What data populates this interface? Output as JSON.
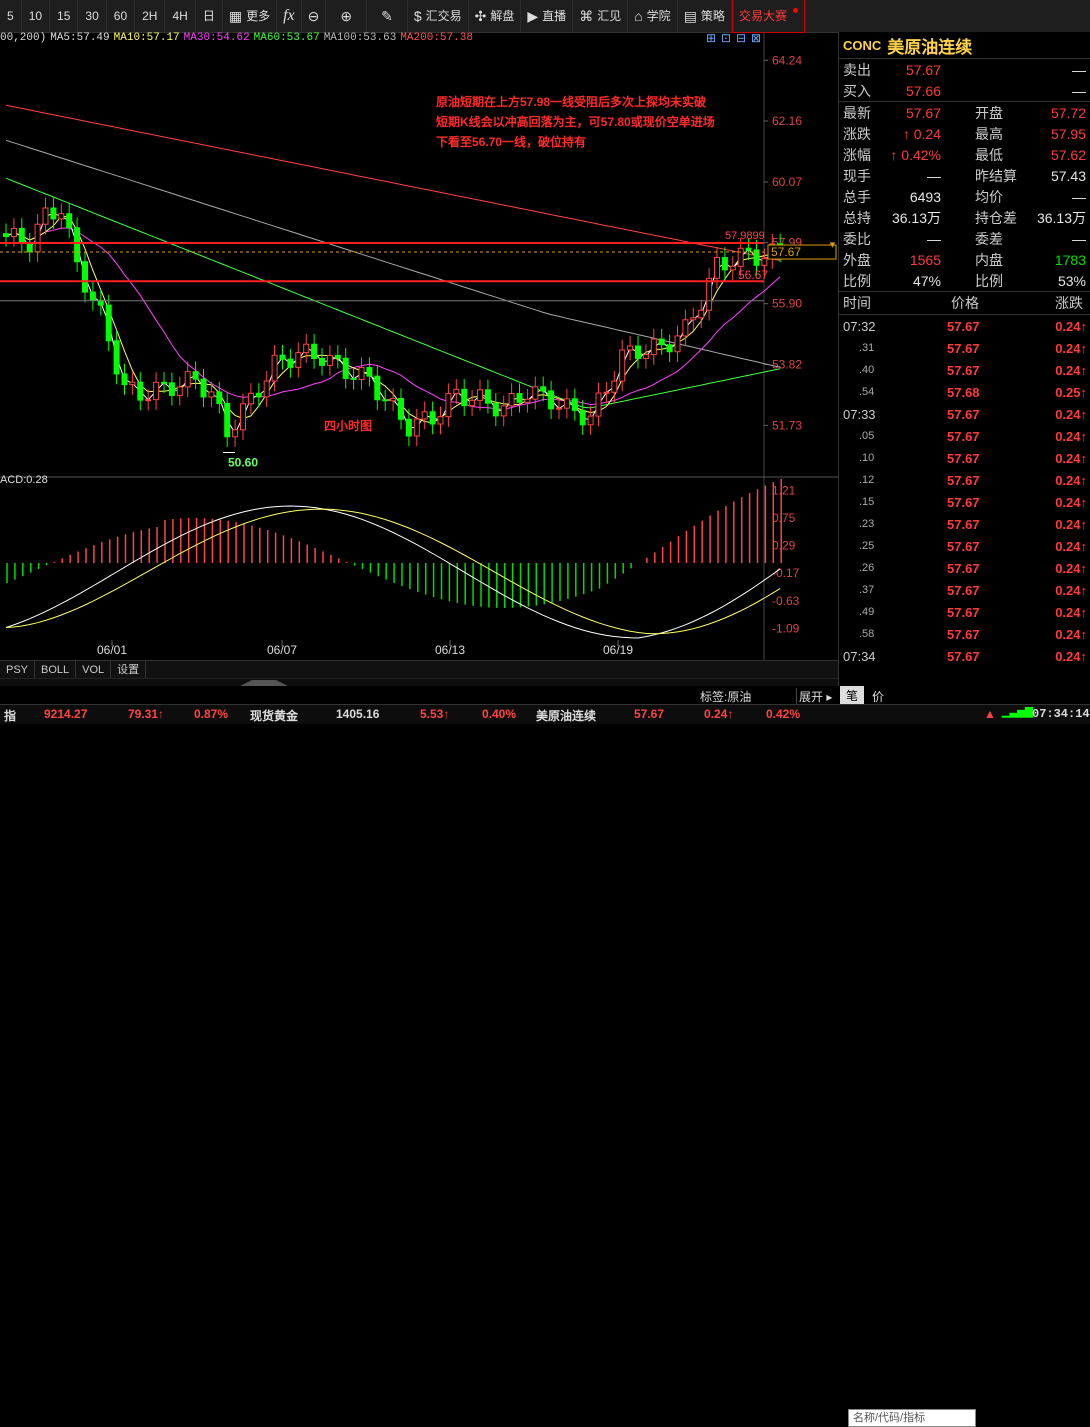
{
  "toolbar": {
    "periods": [
      "5",
      "10",
      "15",
      "30",
      "60",
      "2H",
      "4H",
      "日"
    ],
    "more": "更多",
    "fx": "fx",
    "tools": [
      {
        "label": "汇交易"
      },
      {
        "label": "解盘"
      },
      {
        "label": "直播"
      },
      {
        "label": "汇见"
      },
      {
        "label": "学院"
      },
      {
        "label": "策略"
      },
      {
        "label": "交易大赛"
      }
    ]
  },
  "ma_line": {
    "prefix": "00,200)",
    "ma5": "MA5:57.49",
    "ma10": "MA10:57.17",
    "ma30": "MA30:54.62",
    "ma60": "MA60:53.67",
    "ma100": "MA100:53.63",
    "ma200": "MA200:57.38"
  },
  "colors": {
    "ma5": "#ffffff",
    "ma10": "#ffff66",
    "ma30": "#ff44ff",
    "ma60": "#44ff44",
    "ma100": "#aaaaaa",
    "ma200": "#ff4444",
    "up": "#ff4444",
    "down": "#00ff00",
    "accent": "#ffd24a"
  },
  "annotation": {
    "line1": "原油短期在上方57.98一线受阻后多次上探均未实破",
    "line2": "短期K线会以冲高回落为主，可57.80或现价空单进场",
    "line3": "下看至56.70一线，破位持有",
    "chart_label": "四小时图"
  },
  "chart_data": [
    {
      "type": "candlestick",
      "name": "四小时图",
      "ylim": [
        50.2,
        64.8
      ],
      "y_ticks": [
        "64.24",
        "62.16",
        "60.07",
        "57.99",
        "55.90",
        "53.82",
        "51.73"
      ],
      "x_labels": [
        "06/01",
        "06/07",
        "06/13",
        "06/19"
      ],
      "low_marker": "50.60",
      "current_price": "57.67",
      "high_marker": "57.98",
      "low_line_label": "56.67",
      "overlap_label": "57.9899",
      "resistance": 57.98,
      "support": 56.67,
      "ma5_end": 57.49,
      "ma10_end": 57.17,
      "ma30_end": 54.62,
      "ma60_end": 53.67,
      "ma100_end": 53.63,
      "ma200_end": 57.38
    },
    {
      "type": "bar",
      "name": "MACD",
      "label": "ACD:0.28",
      "ylim": [
        -1.35,
        1.35
      ],
      "y_ticks": [
        "1.21",
        "0.75",
        "0.29",
        "-0.17",
        "-0.63",
        "-1.09"
      ]
    }
  ],
  "quote": {
    "code": "CONC",
    "name": "美原油连续",
    "rows": [
      {
        "k1": "卖出",
        "v1": "57.67",
        "v1c": "red",
        "k2": "",
        "v2": "—",
        "v2c": "wht"
      },
      {
        "k1": "买入",
        "v1": "57.66",
        "v1c": "red",
        "k2": "",
        "v2": "—",
        "v2c": "wht"
      },
      {
        "k1": "最新",
        "v1": "57.67",
        "v1c": "red",
        "k2": "开盘",
        "v2": "57.72",
        "v2c": "red"
      },
      {
        "k1": "涨跌",
        "v1": "↑ 0.24",
        "v1c": "red",
        "k2": "最高",
        "v2": "57.95",
        "v2c": "red"
      },
      {
        "k1": "涨幅",
        "v1": "↑ 0.42%",
        "v1c": "red",
        "k2": "最低",
        "v2": "57.62",
        "v2c": "red"
      },
      {
        "k1": "现手",
        "v1": "—",
        "v1c": "wht",
        "k2": "昨结算",
        "v2": "57.43",
        "v2c": "wht"
      },
      {
        "k1": "总手",
        "v1": "6493",
        "v1c": "wht",
        "k2": "均价",
        "v2": "—",
        "v2c": "wht"
      },
      {
        "k1": "总持",
        "v1": "36.13万",
        "v1c": "wht",
        "k2": "持仓差",
        "v2": "36.13万",
        "v2c": "wht"
      },
      {
        "k1": "委比",
        "v1": "—",
        "v1c": "wht",
        "k2": "委差",
        "v2": "—",
        "v2c": "wht"
      },
      {
        "k1": "外盘",
        "v1": "1565",
        "v1c": "red",
        "k2": "内盘",
        "v2": "1783",
        "v2c": "grn"
      },
      {
        "k1": "比例",
        "v1": "47%",
        "v1c": "wht",
        "k2": "比例",
        "v2": "53%",
        "v2c": "wht"
      }
    ],
    "ticks_header": {
      "time": "时间",
      "price": "价格",
      "change": "涨跌"
    },
    "ticks": [
      {
        "time": "07:32",
        "sub": "",
        "price": "57.67",
        "chg": "0.24↑"
      },
      {
        "time": "",
        "sub": "31",
        "price": "57.67",
        "chg": "0.24↑"
      },
      {
        "time": "",
        "sub": "40",
        "price": "57.67",
        "chg": "0.24↑"
      },
      {
        "time": "",
        "sub": "54",
        "price": "57.68",
        "chg": "0.25↑"
      },
      {
        "time": "07:33",
        "sub": "",
        "price": "57.67",
        "chg": "0.24↑"
      },
      {
        "time": "",
        "sub": "05",
        "price": "57.67",
        "chg": "0.24↑"
      },
      {
        "time": "",
        "sub": "10",
        "price": "57.67",
        "chg": "0.24↑"
      },
      {
        "time": "",
        "sub": "12",
        "price": "57.67",
        "chg": "0.24↑"
      },
      {
        "time": "",
        "sub": "15",
        "price": "57.67",
        "chg": "0.24↑"
      },
      {
        "time": "",
        "sub": "23",
        "price": "57.67",
        "chg": "0.24↑"
      },
      {
        "time": "",
        "sub": "25",
        "price": "57.67",
        "chg": "0.24↑"
      },
      {
        "time": "",
        "sub": "26",
        "price": "57.67",
        "chg": "0.24↑"
      },
      {
        "time": "",
        "sub": "37",
        "price": "57.67",
        "chg": "0.24↑"
      },
      {
        "time": "",
        "sub": "49",
        "price": "57.67",
        "chg": "0.24↑"
      },
      {
        "time": "",
        "sub": "58",
        "price": "57.67",
        "chg": "0.24↑"
      },
      {
        "time": "07:34",
        "sub": "",
        "price": "57.67",
        "chg": "0.24↑"
      }
    ]
  },
  "bottom_tabs": [
    "PSY",
    "BOLL",
    "VOL",
    "设置"
  ],
  "tag_label": "标签:原油",
  "right_tabs": {
    "expand": "展开",
    "pen": "笔",
    "price": "价"
  },
  "status": {
    "item1_name": "指",
    "item1_value": "9214.27",
    "item1_chg": "79.31↑",
    "item1_pct": "0.87%",
    "item2_name": "现货黄金",
    "item2_value": "1405.16",
    "item2_chg": "5.53↑",
    "item2_pct": "0.40%",
    "item3_name": "美原油连续",
    "item3_value": "57.67",
    "item3_chg": "0.24↑",
    "item3_pct": "0.42%",
    "search_placeholder": "名称/代码/指标",
    "time": "07:34:14"
  }
}
